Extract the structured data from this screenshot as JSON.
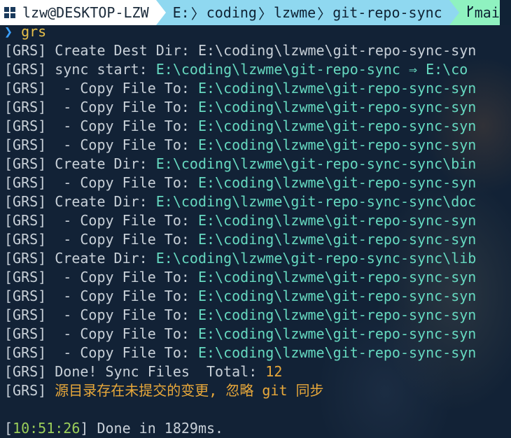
{
  "prompt": {
    "os_icon": "windows-icon",
    "user_host": "lzw@DESKTOP-LZW",
    "path_parts": [
      "E:",
      "coding",
      "lzwme",
      "git-repo-sync"
    ],
    "git_icon": "branch-icon",
    "git_branch": "mai"
  },
  "command": {
    "caret": "❯",
    "text": "grs"
  },
  "output": [
    {
      "tag": "[GRS]",
      "label": " Create Dest Dir: ",
      "value": "E:\\coding\\lzwme\\git-repo-sync-syn",
      "value_color": "label"
    },
    {
      "tag": "[GRS]",
      "label": " sync start: ",
      "value": "E:\\coding\\lzwme\\git-repo-sync ⇒ E:\\co",
      "value_color": "path"
    },
    {
      "tag": "[GRS]",
      "label": "  - Copy File To: ",
      "value": "E:\\coding\\lzwme\\git-repo-sync-syn",
      "value_color": "path"
    },
    {
      "tag": "[GRS]",
      "label": "  - Copy File To: ",
      "value": "E:\\coding\\lzwme\\git-repo-sync-syn",
      "value_color": "path"
    },
    {
      "tag": "[GRS]",
      "label": "  - Copy File To: ",
      "value": "E:\\coding\\lzwme\\git-repo-sync-syn",
      "value_color": "path"
    },
    {
      "tag": "[GRS]",
      "label": "  - Copy File To: ",
      "value": "E:\\coding\\lzwme\\git-repo-sync-syn",
      "value_color": "path"
    },
    {
      "tag": "[GRS]",
      "label": " Create Dir: ",
      "value": "E:\\coding\\lzwme\\git-repo-sync-sync\\bin",
      "value_color": "path"
    },
    {
      "tag": "[GRS]",
      "label": "  - Copy File To: ",
      "value": "E:\\coding\\lzwme\\git-repo-sync-syn",
      "value_color": "path"
    },
    {
      "tag": "[GRS]",
      "label": " Create Dir: ",
      "value": "E:\\coding\\lzwme\\git-repo-sync-sync\\doc",
      "value_color": "path"
    },
    {
      "tag": "[GRS]",
      "label": "  - Copy File To: ",
      "value": "E:\\coding\\lzwme\\git-repo-sync-syn",
      "value_color": "path"
    },
    {
      "tag": "[GRS]",
      "label": "  - Copy File To: ",
      "value": "E:\\coding\\lzwme\\git-repo-sync-syn",
      "value_color": "path"
    },
    {
      "tag": "[GRS]",
      "label": " Create Dir: ",
      "value": "E:\\coding\\lzwme\\git-repo-sync-sync\\lib",
      "value_color": "path"
    },
    {
      "tag": "[GRS]",
      "label": "  - Copy File To: ",
      "value": "E:\\coding\\lzwme\\git-repo-sync-syn",
      "value_color": "path"
    },
    {
      "tag": "[GRS]",
      "label": "  - Copy File To: ",
      "value": "E:\\coding\\lzwme\\git-repo-sync-syn",
      "value_color": "path"
    },
    {
      "tag": "[GRS]",
      "label": "  - Copy File To: ",
      "value": "E:\\coding\\lzwme\\git-repo-sync-syn",
      "value_color": "path"
    },
    {
      "tag": "[GRS]",
      "label": "  - Copy File To: ",
      "value": "E:\\coding\\lzwme\\git-repo-sync-syn",
      "value_color": "path"
    },
    {
      "tag": "[GRS]",
      "label": "  - Copy File To: ",
      "value": "E:\\coding\\lzwme\\git-repo-sync-syn",
      "value_color": "path"
    }
  ],
  "done_line": {
    "tag": "[GRS]",
    "label": " Done! Sync Files  Total: ",
    "total": "12"
  },
  "warning_line": {
    "tag": "[GRS]",
    "text": " 源目录存在未提交的变更, 忽略 git 同步"
  },
  "footer": {
    "open_bracket": "[",
    "time": "10:51:26",
    "close_bracket": "]",
    "text": " Done in 1829ms."
  },
  "colors": {
    "background": "#122236",
    "text": "#c8d0d8",
    "path": "#66d9c0",
    "gold": "#e8a83a",
    "time": "#9ccf5a",
    "prompt_path_bg": "#8fd8f0",
    "prompt_git_bg": "#8ff2c0"
  }
}
